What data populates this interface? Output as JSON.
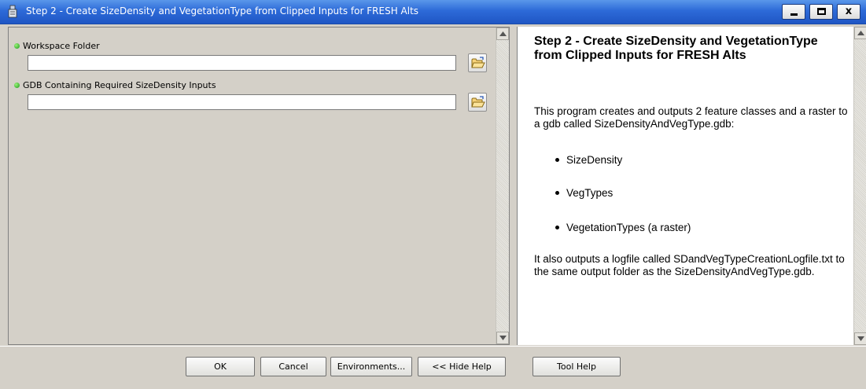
{
  "window": {
    "title": "Step 2 - Create SizeDensity and VegetationType from Clipped Inputs for FRESH Alts",
    "icon": "arcgis-tool-icon",
    "controls": {
      "minimize": "_",
      "maximize": "□",
      "close": "x"
    }
  },
  "parameters": [
    {
      "label": "Workspace Folder",
      "value": "",
      "required": true,
      "browse_icon": "folder-open-icon"
    },
    {
      "label": "GDB Containing Required SizeDensity Inputs",
      "value": "",
      "required": true,
      "browse_icon": "folder-open-icon"
    }
  ],
  "help": {
    "title": "Step 2 - Create SizeDensity and VegetationType from Clipped Inputs for FRESH Alts",
    "intro": "This program creates and outputs 2 feature classes and a raster to a gdb called SizeDensityAndVegType.gdb:",
    "bullets": [
      "SizeDensity",
      "VegTypes",
      "VegetationTypes (a raster)"
    ],
    "outro": "It also outputs a logfile called SDandVegTypeCreationLogfile.txt to the same output folder as the SizeDensityAndVegType.gdb."
  },
  "buttons": {
    "ok": "OK",
    "cancel": "Cancel",
    "environments": "Environments...",
    "hide_help": "<< Hide Help",
    "tool_help": "Tool Help"
  },
  "colors": {
    "titlebar": "#2d6ad8",
    "dialog_bg": "#d4d0c8",
    "required_dot": "#1a9a1a"
  }
}
